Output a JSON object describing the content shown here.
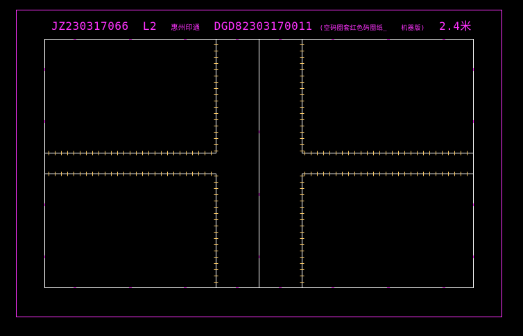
{
  "title": {
    "part1": "JZ230317066",
    "part2": "L2",
    "part3": "惠州印通",
    "part4": "DGD82303170011",
    "part5": "(空码圈套红色码圈纸_",
    "part6": "机器版)",
    "part7": "2.4米"
  },
  "colors": {
    "background": "#000000",
    "frame": "#ff33ff",
    "outline": "#ffffff",
    "ticks": "#ffcc66",
    "markers": "#ff33ff"
  }
}
